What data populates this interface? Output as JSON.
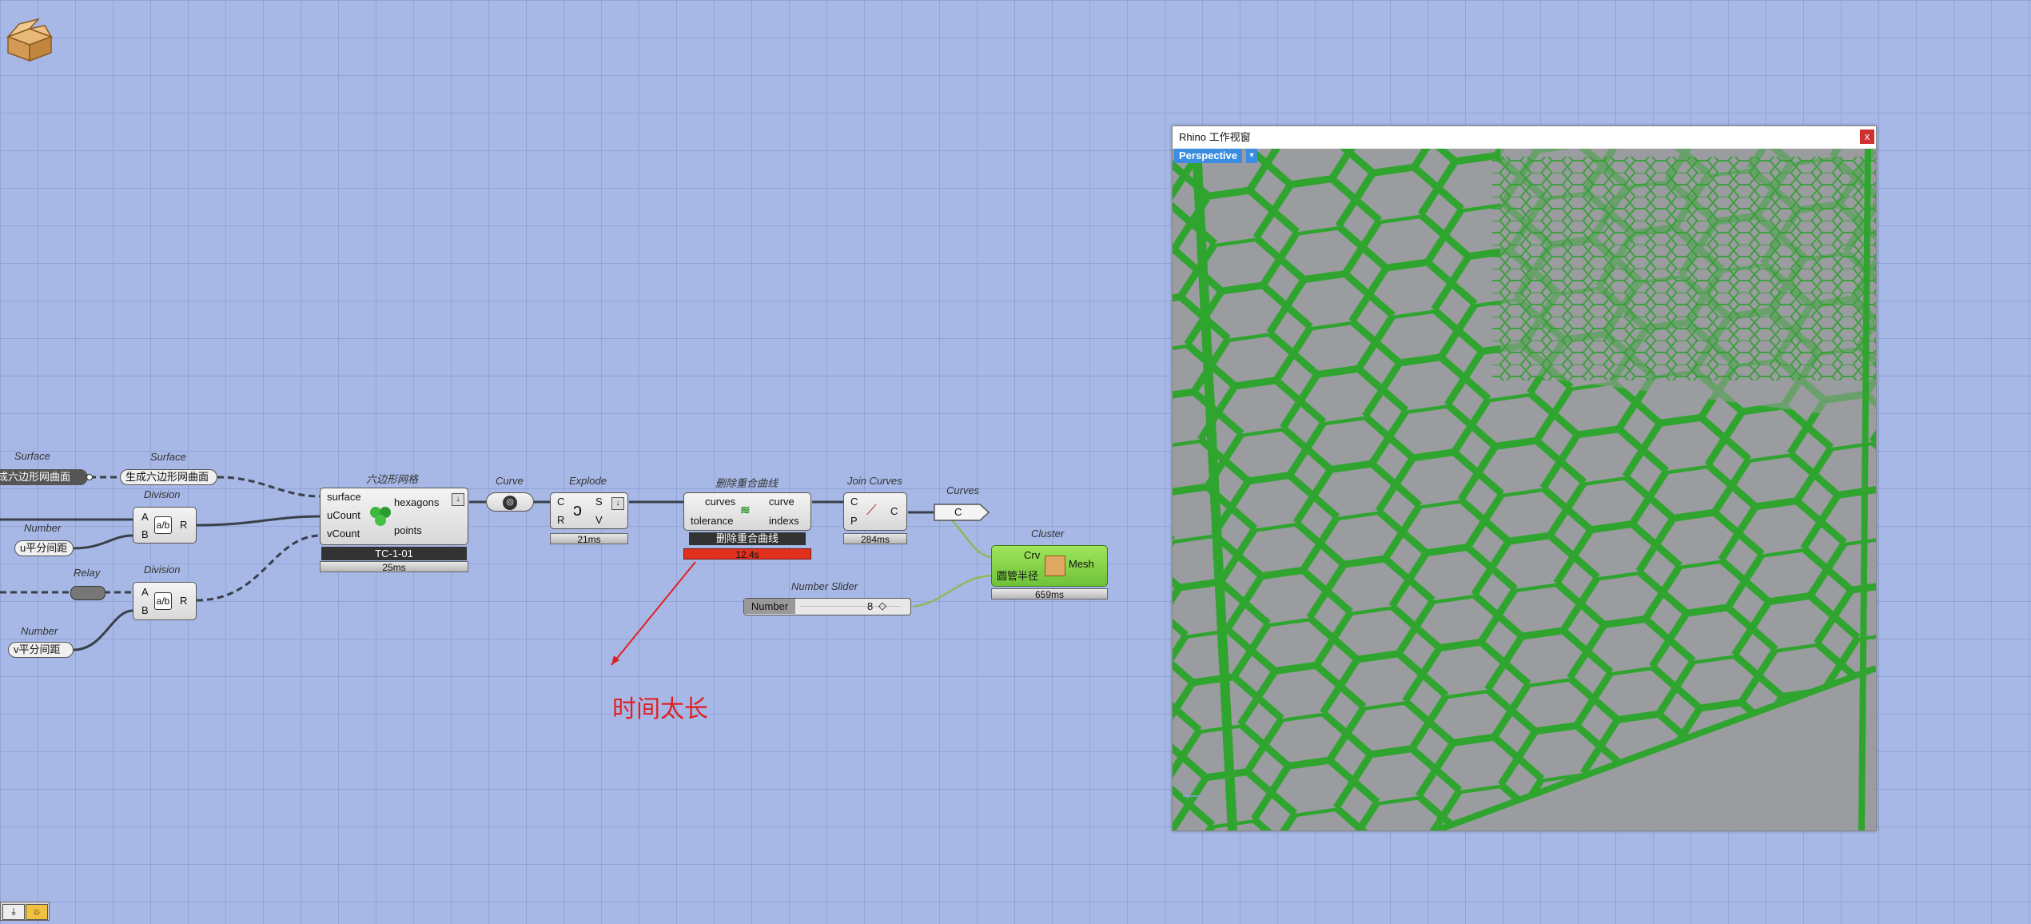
{
  "app_icon": "cardboard-box-icon",
  "colors": {
    "canvas": "#a7b8e6",
    "error_bar": "#e0301e",
    "cluster_green": "#7fd13a",
    "hex_green": "#2faa2f",
    "viewport_grey": "#9a9c9f",
    "annotation_red": "#e02020"
  },
  "components": {
    "surface_label1": "Surface",
    "surface_panel1": "成六边形网曲面",
    "surface_label2": "Surface",
    "surface_panel2": "生成六边形网曲面",
    "division1_label": "Division",
    "division1_in_a": "A",
    "division1_in_b": "B",
    "division1_out": "R",
    "number1_label": "Number",
    "number1_panel": "u平分间距",
    "relay_label": "Relay",
    "division2_label": "Division",
    "division2_in_a": "A",
    "division2_in_b": "B",
    "division2_out": "R",
    "number2_label": "Number",
    "number2_panel": "v平分间距",
    "hexgrid_label": "六边形网格",
    "hexgrid_in": [
      "surface",
      "uCount",
      "vCount"
    ],
    "hexgrid_out": [
      "hexagons",
      "points"
    ],
    "hexgrid_tag": "TC-1-01",
    "hexgrid_time": "25ms",
    "curve_label": "Curve",
    "explode_label": "Explode",
    "explode_in": [
      "C",
      "R"
    ],
    "explode_out": [
      "S",
      "V"
    ],
    "explode_time": "21ms",
    "dedupe_label": "删除重合曲线",
    "dedupe_in": [
      "curves",
      "tolerance"
    ],
    "dedupe_out": [
      "curve",
      "indexs"
    ],
    "dedupe_tag": "删除重合曲线",
    "dedupe_time": "12.4s",
    "join_label": "Join Curves",
    "join_in": [
      "C",
      "P"
    ],
    "join_out": "C",
    "join_time": "284ms",
    "curves_label": "Curves",
    "curves_param": "C",
    "cluster_label": "Cluster",
    "cluster_in": [
      "Crv",
      "圆管半径"
    ],
    "cluster_out": "Mesh",
    "cluster_time": "659ms",
    "slider_label": "Number Slider",
    "slider_name": "Number",
    "slider_value": "8"
  },
  "annotation": {
    "text": "时间太长"
  },
  "rhino": {
    "title": "Rhino 工作视窗",
    "close": "x",
    "viewport": "Perspective",
    "viewport_menu": "▾"
  },
  "bottom_toolbar": {
    "icons": [
      "download-icon",
      "preview-icon"
    ]
  }
}
